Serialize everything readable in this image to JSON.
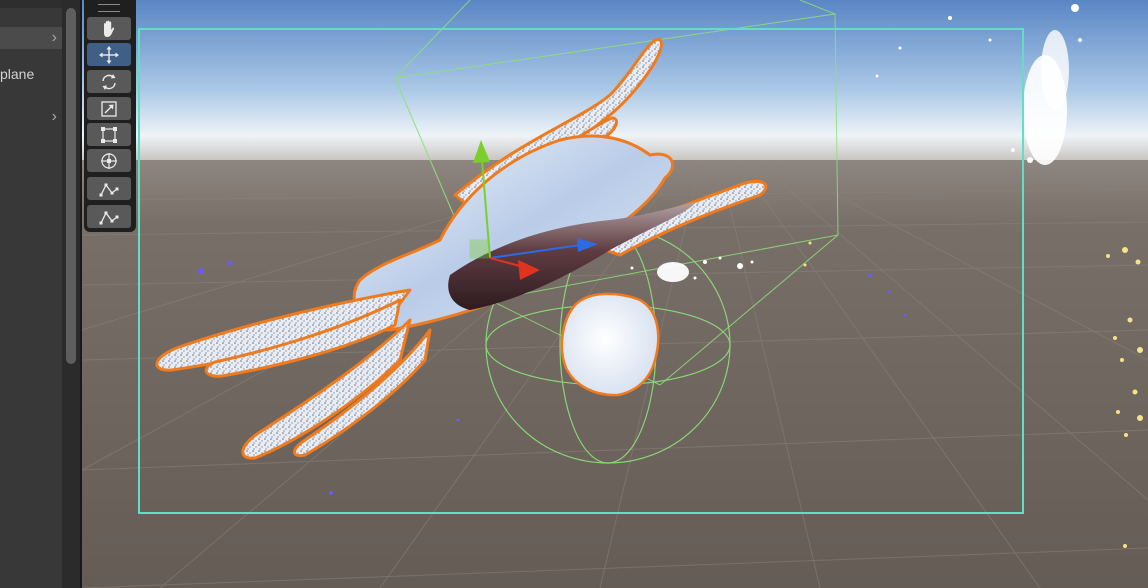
{
  "hierarchy": {
    "items": [
      {
        "label": "",
        "expandable": true,
        "selected": true
      },
      {
        "label": "plane",
        "expandable": false,
        "selected": false
      },
      {
        "label": "",
        "expandable": true,
        "selected": false
      }
    ]
  },
  "tools": [
    {
      "name": "hand-tool",
      "icon": "hand-icon",
      "active": false
    },
    {
      "name": "move-tool",
      "icon": "move-arrows-icon",
      "active": true
    },
    {
      "name": "rotate-tool",
      "icon": "rotate-icon",
      "active": false
    },
    {
      "name": "scale-tool",
      "icon": "scale-icon",
      "active": false
    },
    {
      "name": "rect-tool",
      "icon": "rect-transform-icon",
      "active": false
    },
    {
      "name": "transform-tool",
      "icon": "transform-icon",
      "active": false
    },
    {
      "name": "custom-tool-1",
      "icon": "path-editor-icon",
      "active": false
    },
    {
      "name": "custom-tool-2",
      "icon": "path-editor-icon",
      "active": false
    }
  ],
  "colors": {
    "panel": "#383838",
    "toolbar": "#1f1f1f",
    "tool_button": "#595959",
    "tool_active": "#3f5f87",
    "selection_outline": "#f07a1e",
    "bounds_rect": "#5fe0c4",
    "collider_wire": "#8ee07a",
    "gizmo_x": "#e0331f",
    "gizmo_y": "#7ccf2a",
    "gizmo_z": "#2f6be0"
  }
}
